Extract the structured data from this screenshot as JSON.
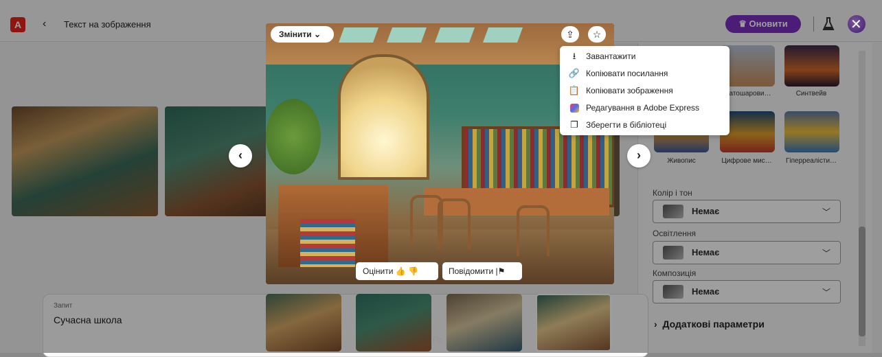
{
  "header": {
    "title": "Текст на зображення",
    "update_label": "Оновити"
  },
  "main": {
    "change_label": "Змінити",
    "rate_label": "Оцінити",
    "report_label": "Повідомити"
  },
  "menu": {
    "items": [
      {
        "label": "Завантажити",
        "icon": "download-icon"
      },
      {
        "label": "Копіювати посилання",
        "icon": "link-icon"
      },
      {
        "label": "Копіювати зображення",
        "icon": "clipboard-icon"
      },
      {
        "label": "Редагування в Adobe Express",
        "icon": "adobe-express-icon"
      },
      {
        "label": "Зберегти в бібліотеці",
        "icon": "library-icon"
      }
    ]
  },
  "prompt": {
    "label": "Запит",
    "text": "Сучасна школа",
    "generate_label": "Пр"
  },
  "styles": {
    "items": [
      {
        "label": "…атошарови…"
      },
      {
        "label": "Синтвейв"
      },
      {
        "label": "Живопис"
      },
      {
        "label": "Цифрове мис…"
      },
      {
        "label": "Гіперреалісти…"
      }
    ]
  },
  "panel": {
    "color_label": "Колір і тон",
    "color_value": "Немає",
    "lighting_label": "Освітлення",
    "lighting_value": "Немає",
    "composition_label": "Композиція",
    "composition_value": "Немає",
    "more_label": "Додаткові параметри"
  },
  "colors": {
    "update_button": "#7a2fc0",
    "logo": "#e8221b"
  }
}
